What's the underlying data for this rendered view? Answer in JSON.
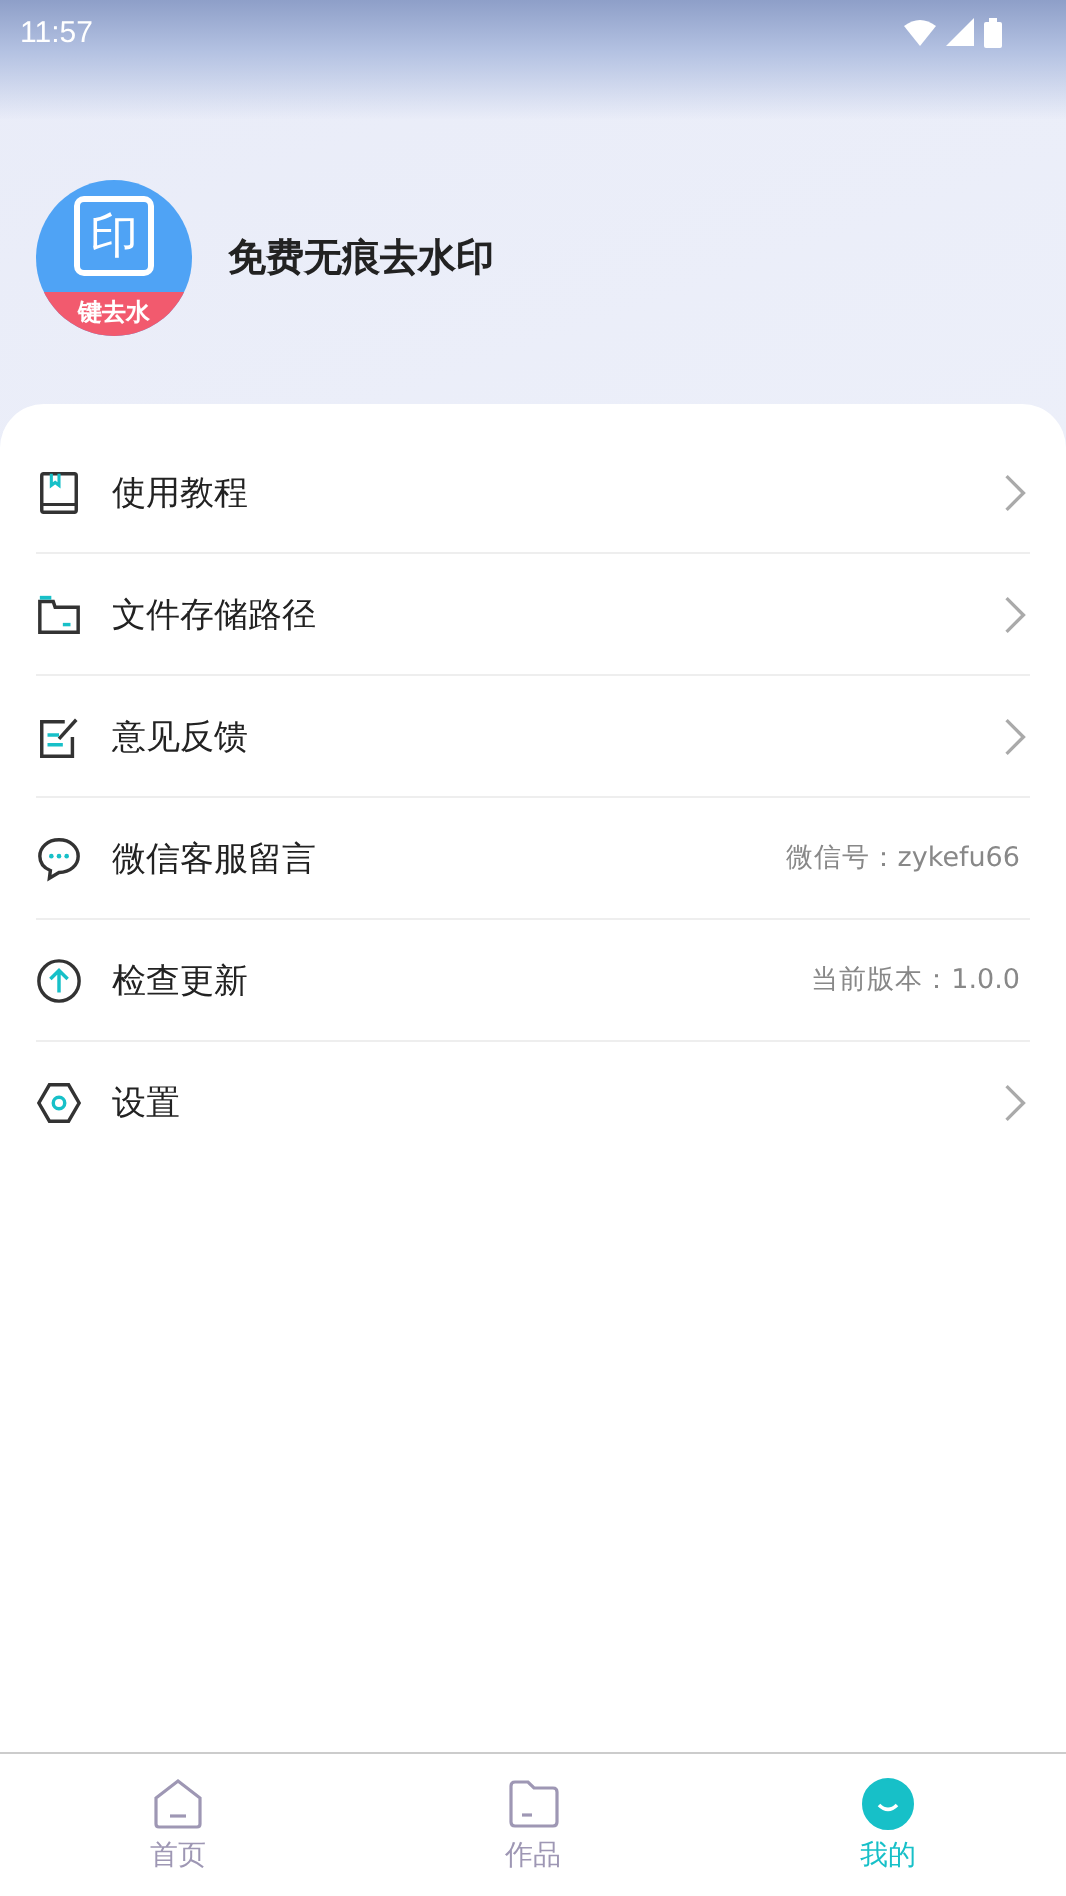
{
  "status_bar": {
    "time": "11:57"
  },
  "profile": {
    "avatar_mark": "印",
    "avatar_banner": "键去水",
    "name": "免费无痕去水印"
  },
  "menu": [
    {
      "kind": "link",
      "label": "使用教程"
    },
    {
      "kind": "link",
      "label": "文件存储路径"
    },
    {
      "kind": "link",
      "label": "意见反馈"
    },
    {
      "kind": "info",
      "label": "微信客服留言",
      "value": "微信号：zykefu66"
    },
    {
      "kind": "info",
      "label": "检查更新",
      "value": "当前版本：1.0.0"
    },
    {
      "kind": "link",
      "label": "设置"
    }
  ],
  "tabs": [
    {
      "label": "首页",
      "selected": false
    },
    {
      "label": "作品",
      "selected": false
    },
    {
      "label": "我的",
      "selected": true
    }
  ]
}
